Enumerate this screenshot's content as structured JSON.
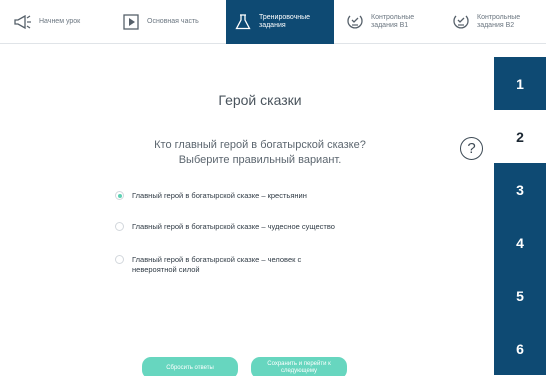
{
  "colors": {
    "nav_active": "#0e4a73",
    "accent_teal": "#67d6bf",
    "radio_checked": "#5ed0b3"
  },
  "tabs": [
    {
      "label": "Начнем урок",
      "icon": "megaphone-icon",
      "active": false
    },
    {
      "label": "Основная часть",
      "icon": "play-icon",
      "active": false
    },
    {
      "label": "Тренировочные\nзадания",
      "icon": "flask-icon",
      "active": true
    },
    {
      "label": "Контрольные\nзадания В1",
      "icon": "checklist-icon",
      "active": false
    },
    {
      "label": "Контрольные\nзадания В2",
      "icon": "checklist-icon",
      "active": false
    }
  ],
  "steps": [
    "1",
    "2",
    "3",
    "4",
    "5",
    "6"
  ],
  "current_step": "2",
  "task": {
    "title": "Герой сказки",
    "question": "Кто главный герой в богатырской сказке?\nВыберите правильный вариант.",
    "help_icon": "question-mark-icon",
    "help_label": "?"
  },
  "options": [
    {
      "text": "Главный герой в богатырской сказке – крестьянин",
      "checked": true
    },
    {
      "text": "Главный герой в богатырской сказке – чудесное существо",
      "checked": false
    },
    {
      "text": "Главный герой в богатырской сказке – человек с\nневероятной силой",
      "checked": false
    }
  ],
  "buttons": {
    "reset": "Сбросить ответы",
    "save_next": "Сохранить и перейти к\nследующему"
  }
}
